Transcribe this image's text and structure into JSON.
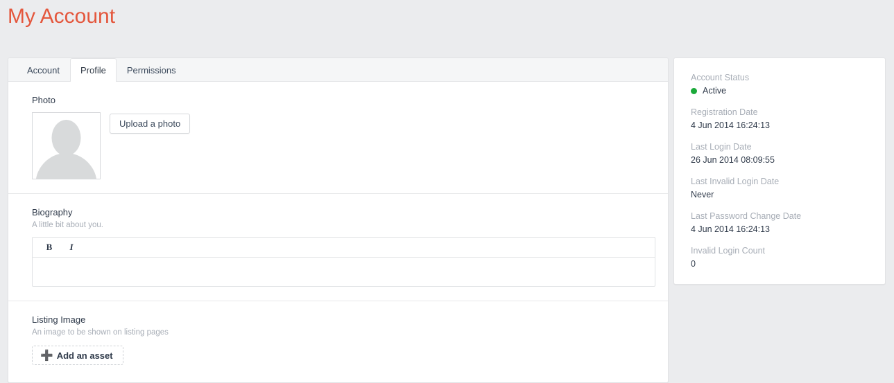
{
  "page": {
    "title": "My Account",
    "title_color": "#e4573d",
    "background_color": "#ebecee"
  },
  "tabs": [
    {
      "label": "Account",
      "active": false
    },
    {
      "label": "Profile",
      "active": true
    },
    {
      "label": "Permissions",
      "active": false
    }
  ],
  "profile": {
    "photo": {
      "label": "Photo",
      "avatar_icon": "user-silhouette-icon",
      "upload_button": "Upload a photo"
    },
    "biography": {
      "label": "Biography",
      "help": "A little bit about you.",
      "toolbar": {
        "bold": "B",
        "italic": "I"
      },
      "value": "",
      "placeholder": ""
    },
    "listing_image": {
      "label": "Listing Image",
      "help": "An image to be shown on listing pages",
      "add_button": "Add an asset",
      "plus_icon": "plus-icon"
    }
  },
  "sidebar": {
    "items": [
      {
        "label": "Account Status",
        "value": "Active",
        "status_dot": true,
        "dot_color": "#1ba939"
      },
      {
        "label": "Registration Date",
        "value": "4 Jun 2014 16:24:13",
        "status_dot": false
      },
      {
        "label": "Last Login Date",
        "value": "26 Jun 2014 08:09:55",
        "status_dot": false
      },
      {
        "label": "Last Invalid Login Date",
        "value": "Never",
        "status_dot": false
      },
      {
        "label": "Last Password Change Date",
        "value": "4 Jun 2014 16:24:13",
        "status_dot": false
      },
      {
        "label": "Invalid Login Count",
        "value": "0",
        "status_dot": false
      }
    ]
  }
}
